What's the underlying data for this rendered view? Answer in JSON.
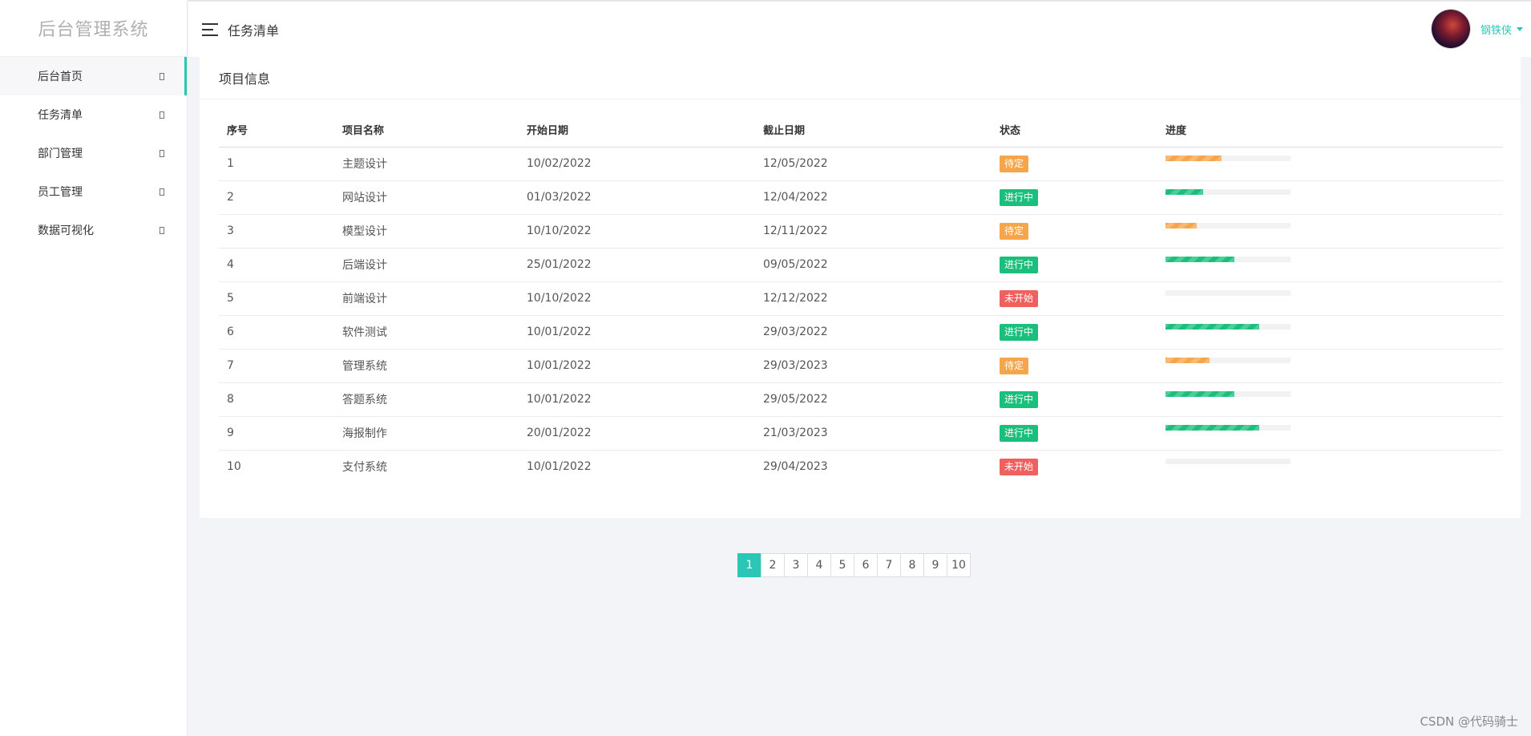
{
  "brand": "后台管理系统",
  "sidebar": {
    "items": [
      {
        "label": "后台首页",
        "active": true
      },
      {
        "label": "任务清单",
        "active": false
      },
      {
        "label": "部门管理",
        "active": false
      },
      {
        "label": "员工管理",
        "active": false
      },
      {
        "label": "数据可视化",
        "active": false
      }
    ]
  },
  "header": {
    "title": "任务清单",
    "user_name": "钢铁侠"
  },
  "card": {
    "title": "项目信息"
  },
  "table": {
    "columns": [
      "序号",
      "项目名称",
      "开始日期",
      "截止日期",
      "状态",
      "进度"
    ],
    "rows": [
      {
        "id": "1",
        "name": "主题设计",
        "start": "10/02/2022",
        "end": "12/05/2022",
        "status": "待定",
        "progress": 45
      },
      {
        "id": "2",
        "name": "网站设计",
        "start": "01/03/2022",
        "end": "12/04/2022",
        "status": "进行中",
        "progress": 30
      },
      {
        "id": "3",
        "name": "模型设计",
        "start": "10/10/2022",
        "end": "12/11/2022",
        "status": "待定",
        "progress": 25
      },
      {
        "id": "4",
        "name": "后端设计",
        "start": "25/01/2022",
        "end": "09/05/2022",
        "status": "进行中",
        "progress": 55
      },
      {
        "id": "5",
        "name": "前端设计",
        "start": "10/10/2022",
        "end": "12/12/2022",
        "status": "未开始",
        "progress": 0
      },
      {
        "id": "6",
        "name": "软件测试",
        "start": "10/01/2022",
        "end": "29/03/2022",
        "status": "进行中",
        "progress": 75
      },
      {
        "id": "7",
        "name": "管理系统",
        "start": "10/01/2022",
        "end": "29/03/2023",
        "status": "待定",
        "progress": 35
      },
      {
        "id": "8",
        "name": "答题系统",
        "start": "10/01/2022",
        "end": "29/05/2022",
        "status": "进行中",
        "progress": 55
      },
      {
        "id": "9",
        "name": "海报制作",
        "start": "20/01/2022",
        "end": "21/03/2023",
        "status": "进行中",
        "progress": 75
      },
      {
        "id": "10",
        "name": "支付系统",
        "start": "10/01/2022",
        "end": "29/04/2023",
        "status": "未开始",
        "progress": 0
      }
    ]
  },
  "status_colors": {
    "待定": "#f7a54a",
    "进行中": "#1bbf7c",
    "未开始": "#f0605f"
  },
  "accent_color": "#2bc6b6",
  "pagination": {
    "pages": [
      "1",
      "2",
      "3",
      "4",
      "5",
      "6",
      "7",
      "8",
      "9",
      "10"
    ],
    "current": "1"
  },
  "watermark": "CSDN @代码骑士"
}
